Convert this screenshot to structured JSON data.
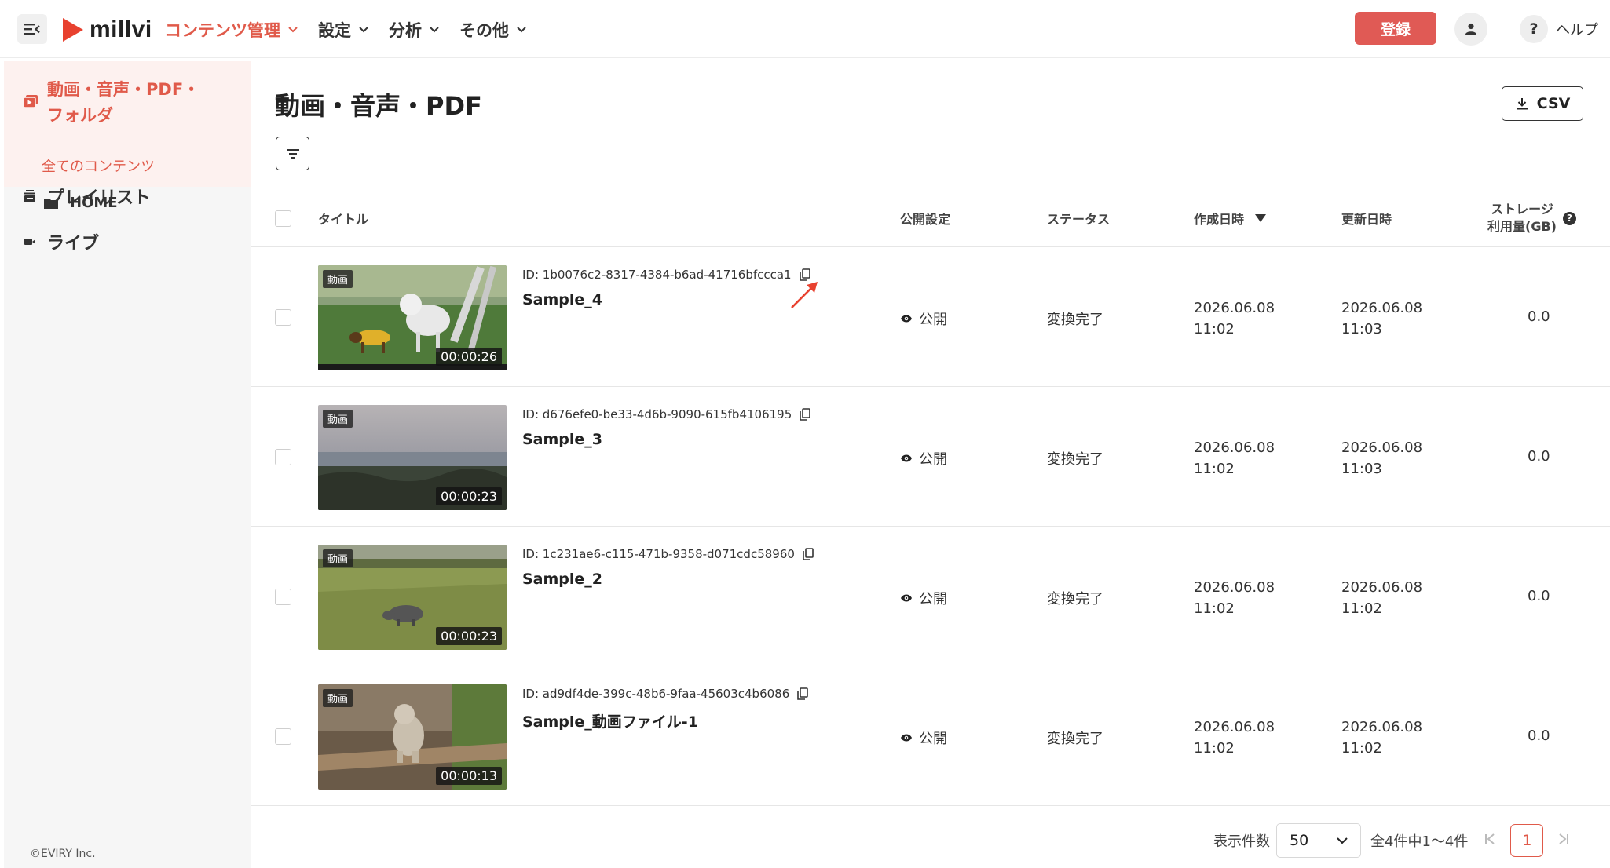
{
  "header": {
    "brand": "millvi",
    "nav": [
      {
        "label": "コンテンツ管理",
        "active": true
      },
      {
        "label": "設定",
        "active": false
      },
      {
        "label": "分析",
        "active": false
      },
      {
        "label": "その他",
        "active": false
      }
    ],
    "register_label": "登録",
    "help_label": "ヘルプ",
    "help_glyph": "?"
  },
  "sidebar": {
    "active_section": "動画・音声・PDF・フォルダ",
    "active_sub": "全てのコンテンツ",
    "home_label": "HOME",
    "playlist_label": "プレイリスト",
    "live_label": "ライブ",
    "copyright": "©EVIRY Inc."
  },
  "main": {
    "title": "動画・音声・PDF",
    "csv_label": "CSV"
  },
  "table": {
    "headers": {
      "title": "タイトル",
      "public": "公開設定",
      "status": "ステータス",
      "created": "作成日時",
      "updated": "更新日時",
      "storage_line1": "ストレージ",
      "storage_line2": "利用量(GB)"
    },
    "rows": [
      {
        "badge": "動画",
        "duration": "00:00:26",
        "id": "ID: 1b0076c2-8317-4384-b6ad-41716bfccca1",
        "title": "Sample_4",
        "public": "公開",
        "status": "変換完了",
        "created_date": "2026.06.08",
        "created_time": "11:02",
        "updated_date": "2026.06.08",
        "updated_time": "11:03",
        "storage": "0.0"
      },
      {
        "badge": "動画",
        "duration": "00:00:23",
        "id": "ID: d676efe0-be33-4d6b-9090-615fb4106195",
        "title": "Sample_3",
        "public": "公開",
        "status": "変換完了",
        "created_date": "2026.06.08",
        "created_time": "11:02",
        "updated_date": "2026.06.08",
        "updated_time": "11:03",
        "storage": "0.0"
      },
      {
        "badge": "動画",
        "duration": "00:00:23",
        "id": "ID: 1c231ae6-c115-471b-9358-d071cdc58960",
        "title": "Sample_2",
        "public": "公開",
        "status": "変換完了",
        "created_date": "2026.06.08",
        "created_time": "11:02",
        "updated_date": "2026.06.08",
        "updated_time": "11:02",
        "storage": "0.0"
      },
      {
        "badge": "動画",
        "duration": "00:00:13",
        "id": "ID: ad9df4de-399c-48b6-9faa-45603c4b6086",
        "title": "Sample_動画ファイル-1",
        "public": "公開",
        "status": "変換完了",
        "created_date": "2026.06.08",
        "created_time": "11:02",
        "updated_date": "2026.06.08",
        "updated_time": "11:02",
        "storage": "0.0"
      }
    ]
  },
  "pagination": {
    "per_page_label": "表示件数",
    "per_page_value": "50",
    "range_text": "全4件中1〜4件",
    "current_page": "1"
  },
  "colors": {
    "accent": "#e05a4a",
    "register_bg": "#e05a55",
    "sidebar_bg": "#f6f6f6",
    "sidebar_active_bg": "#fdf1ef",
    "annotation_arrow": "#e8412f"
  }
}
